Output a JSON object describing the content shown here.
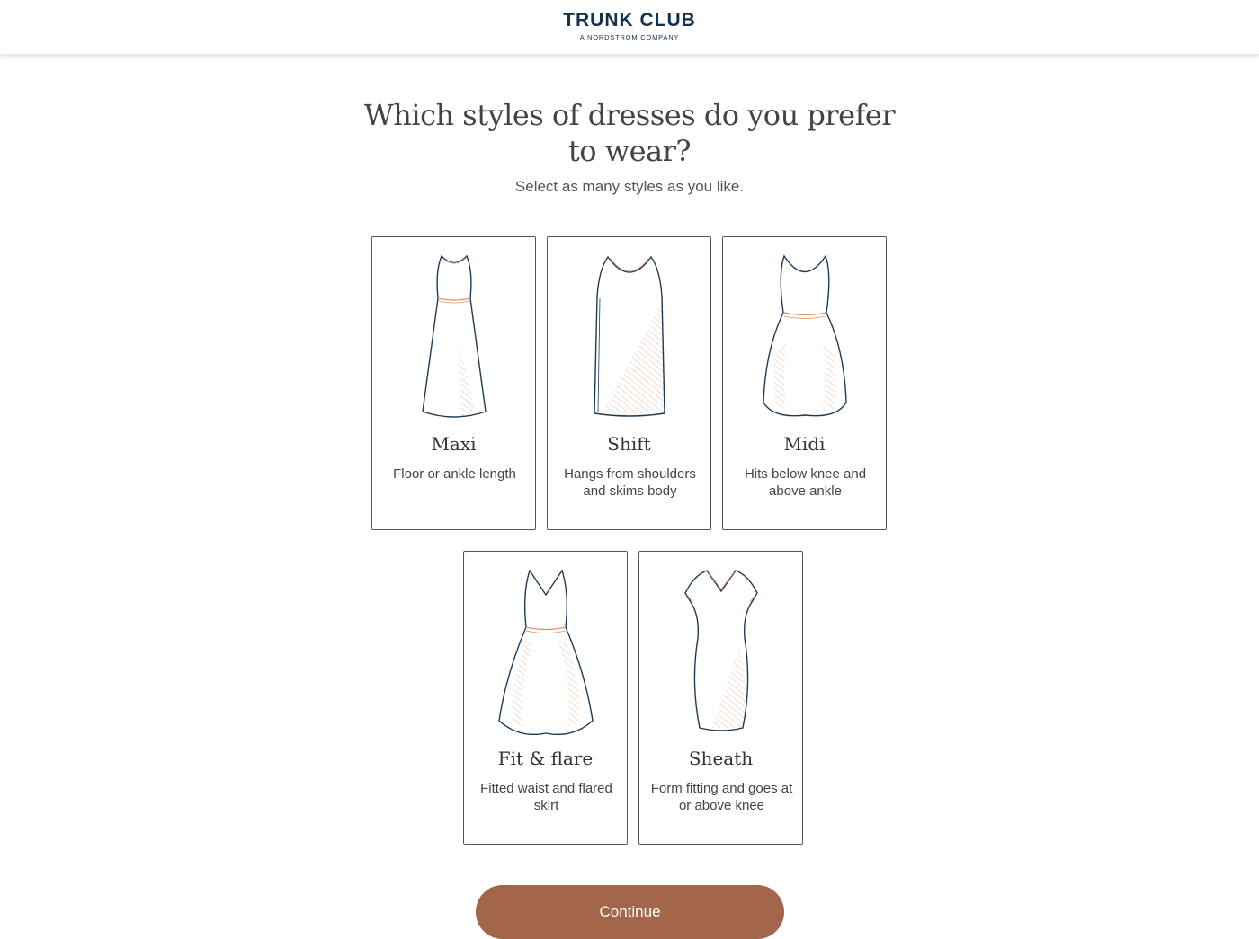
{
  "header": {
    "logo_main": "TRUNK CLUB",
    "logo_sub": "A NORDSTROM COMPANY"
  },
  "question": {
    "title": "Which styles of dresses do you prefer to wear?",
    "subtitle": "Select as many styles as you like."
  },
  "options": [
    {
      "name": "Maxi",
      "description": "Floor or ankle length",
      "icon": "maxi-dress-icon"
    },
    {
      "name": "Shift",
      "description": "Hangs from shoulders and skims body",
      "icon": "shift-dress-icon"
    },
    {
      "name": "Midi",
      "description": "Hits below knee and above ankle",
      "icon": "midi-dress-icon"
    },
    {
      "name": "Fit & flare",
      "description": "Fitted waist and flared skirt",
      "icon": "fit-flare-dress-icon"
    },
    {
      "name": "Sheath",
      "description": "Form fitting and goes at or above knee",
      "icon": "sheath-dress-icon"
    }
  ],
  "continue_label": "Continue",
  "colors": {
    "brand_navy": "#14324f",
    "accent_copper": "#a2664a",
    "illustration_line": "#1d3b57",
    "illustration_accent": "#e0926f"
  }
}
